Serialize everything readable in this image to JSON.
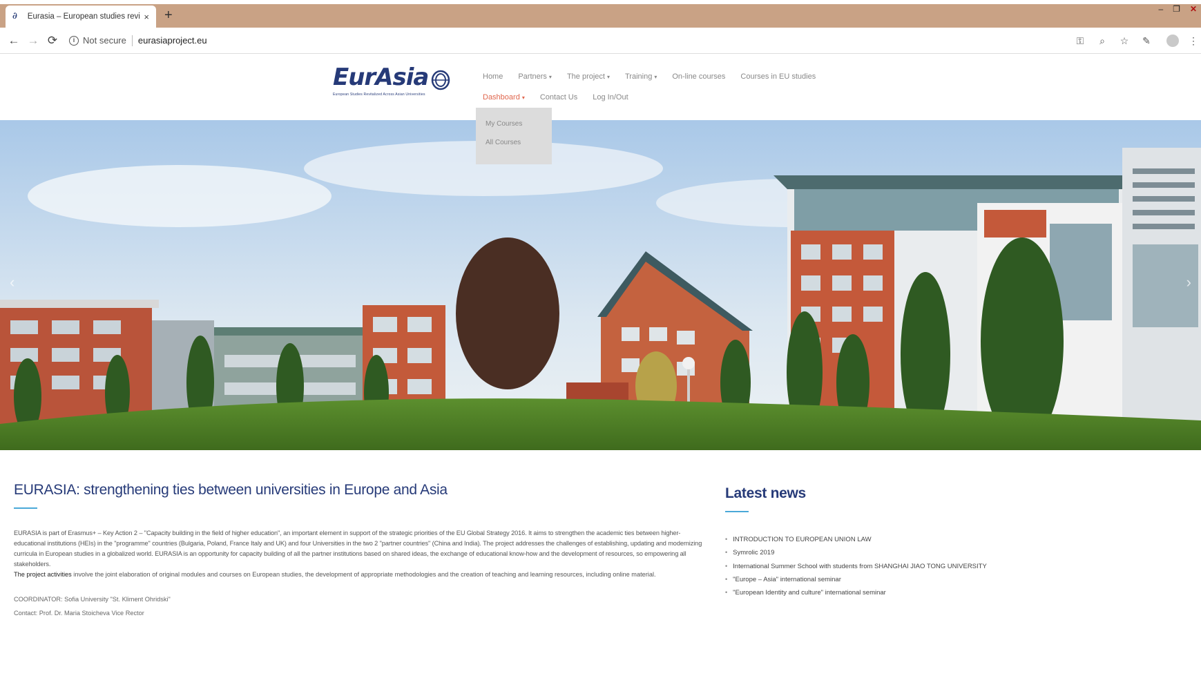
{
  "browser": {
    "tab_title": "Eurasia – European studies revit",
    "tab_close": "×",
    "new_tab": "+",
    "security_label": "Not secure",
    "url": "eurasiaproject.eu",
    "window_controls": [
      "–",
      "❐",
      "✕"
    ]
  },
  "site": {
    "logo_text": "EurAsia",
    "logo_tagline": "European Studies Revitalized Across Asian Universities",
    "menu_row1": [
      {
        "label": "Home",
        "has_caret": false
      },
      {
        "label": "Partners",
        "has_caret": true
      },
      {
        "label": "The project",
        "has_caret": true
      },
      {
        "label": "Training",
        "has_caret": true
      },
      {
        "label": "On-line courses",
        "has_caret": false
      },
      {
        "label": "Courses in EU studies",
        "has_caret": false
      }
    ],
    "menu_row2": [
      {
        "label": "Dashboard",
        "has_caret": true,
        "active": true
      },
      {
        "label": "Contact Us",
        "has_caret": false
      },
      {
        "label": "Log In/Out",
        "has_caret": false
      }
    ],
    "dropdown": [
      "My Courses",
      "All Courses"
    ],
    "caret": "▾",
    "accent_color": "#e0664d",
    "brand_color": "#263a78"
  },
  "hero": {
    "prev_arrow": "‹",
    "next_arrow": "›"
  },
  "main": {
    "title": "EURASIA: strengthening ties between universities in Europe and Asia",
    "paragraph": "EURASIA is part of Erasmus+ – Key Action 2 – \"Capacity building in the field of higher education\", an important element in support of the strategic priorities of the EU Global Strategy 2016. It aims to strengthen the academic ties between higher-educational institutions (HEIs) in the \"programme\" countries (Bulgaria, Poland, France Italy and UK) and four Universities in the two 2 \"partner countries\" (China and India). The project addresses the challenges of establishing, updating and modernizing curricula in European studies in a globalized world. EURASIA is an opportunity for capacity building of all the partner institutions based on shared ideas, the exchange of educational know-how and the development of resources, so empowering all stakeholders.",
    "activities_label": "The project activities",
    "activities_text": " involve the joint elaboration of original modules and courses on European studies, the development of appropriate methodologies and the creation of teaching and learning resources, including online material.",
    "coordinator": "COORDINATOR: Sofia University \"St. Kliment Ohridski\"",
    "contact": "Contact: Prof. Dr. Maria Stoicheva Vice Rector"
  },
  "news": {
    "title": "Latest news",
    "bullet": "•",
    "items": [
      "INTRODUCTION TO EUROPEAN UNION LAW",
      "Symrolic 2019",
      "International Summer School with students from SHANGHAI JIAO TONG UNIVERSITY",
      "\"Europe – Asia\" international seminar",
      "\"European Identity and culture\" international seminar"
    ]
  }
}
